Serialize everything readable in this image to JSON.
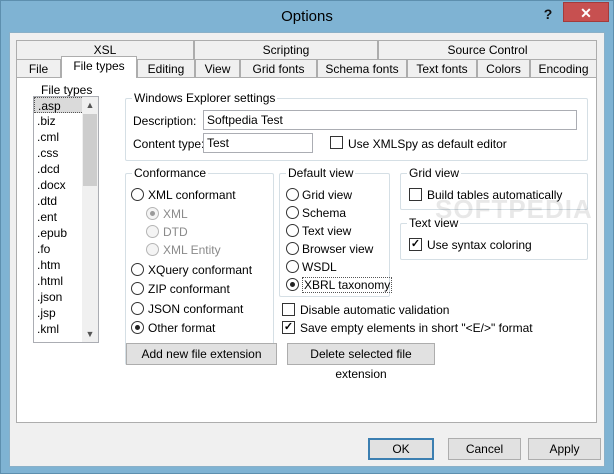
{
  "window": {
    "title": "Options"
  },
  "tabs_row1": [
    "XSL",
    "Scripting",
    "Source Control"
  ],
  "tabs_row2": [
    "File",
    "File types",
    "Editing",
    "View",
    "Grid fonts",
    "Schema fonts",
    "Text fonts",
    "Colors",
    "Encoding"
  ],
  "active_tab": "File types",
  "file_types": {
    "label": "File types",
    "items": [
      ".asp",
      ".biz",
      ".cml",
      ".css",
      ".dcd",
      ".docx",
      ".dtd",
      ".ent",
      ".epub",
      ".fo",
      ".htm",
      ".html",
      ".json",
      ".jsp",
      ".kml"
    ],
    "selected": ".asp"
  },
  "explorer": {
    "label": "Windows Explorer settings",
    "description_label": "Description:",
    "description_value": "Softpedia Test",
    "content_type_label": "Content type:",
    "content_type_value": "Test",
    "default_editor_label": "Use XMLSpy as default editor",
    "default_editor_checked": false
  },
  "conformance": {
    "label": "Conformance",
    "xml_conformant": "XML conformant",
    "xml": "XML",
    "dtd": "DTD",
    "xml_entity": "XML Entity",
    "xquery": "XQuery conformant",
    "zip": "ZIP conformant",
    "json": "JSON conformant",
    "other": "Other format",
    "selected": "Other format"
  },
  "default_view": {
    "label": "Default view",
    "options": [
      "Grid view",
      "Schema",
      "Text view",
      "Browser view",
      "WSDL",
      "XBRL taxonomy"
    ],
    "selected": "XBRL taxonomy"
  },
  "grid_view": {
    "label": "Grid view",
    "build_tables": "Build tables automatically",
    "build_tables_checked": false
  },
  "text_view": {
    "label": "Text view",
    "syntax_coloring": "Use syntax coloring",
    "syntax_coloring_checked": true
  },
  "validation": {
    "disable_auto_validation": "Disable automatic validation",
    "disable_auto_validation_checked": false,
    "save_empty": "Save empty elements in short \"<E/>\" format",
    "save_empty_checked": true
  },
  "buttons": {
    "add_ext": "Add new file extension",
    "delete_ext": "Delete selected file extension",
    "ok": "OK",
    "cancel": "Cancel",
    "apply": "Apply"
  },
  "watermark": "SOFTPEDIA"
}
